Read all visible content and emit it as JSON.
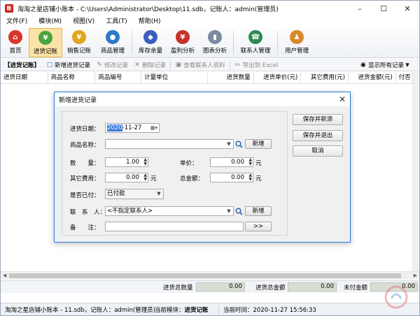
{
  "window": {
    "title": "淘淘之星店铺小账本 - C:\\Users\\Administrator\\Desktop\\11.sdb，记账人：admin(管理员)",
    "app_icon_text": "账"
  },
  "menu": [
    "文件(F)",
    "模块(M)",
    "视图(V)",
    "工具(T)",
    "帮助(H)"
  ],
  "toolbar": [
    {
      "label": "首页",
      "icon": "home-icon",
      "color": "#d9362a",
      "glyph": "⌂"
    },
    {
      "label": "进货记账",
      "icon": "purchase-icon",
      "color": "#4aa53c",
      "glyph": "¥",
      "active": true
    },
    {
      "label": "销售记账",
      "icon": "sales-icon",
      "color": "#e2a51b",
      "glyph": "¥"
    },
    {
      "label": "商品管理",
      "icon": "goods-icon",
      "color": "#2d78c8",
      "glyph": "●"
    },
    {
      "label": "库存余量",
      "icon": "stock-icon",
      "color": "#3b5fc0",
      "glyph": "◆"
    },
    {
      "label": "盈利分析",
      "icon": "profit-icon",
      "color": "#c8322a",
      "glyph": "¥"
    },
    {
      "label": "图表分析",
      "icon": "chart-icon",
      "color": "#7a8aa0",
      "glyph": "▮"
    },
    {
      "label": "联系人管理",
      "icon": "contacts-icon",
      "color": "#2f8a52",
      "glyph": "☎"
    },
    {
      "label": "用户管理",
      "icon": "users-icon",
      "color": "#d68a2a",
      "glyph": "♟"
    }
  ],
  "subbar": {
    "title": "【进货记账】",
    "new": "新增进货记录",
    "edit": "修改记录",
    "delete": "删除记录",
    "view_contact": "查看联系人资料",
    "export": "导出到 Excel",
    "show_all": "显示所有记录"
  },
  "columns": [
    "进货日期",
    "商品名称",
    "商品编号",
    "计量单位",
    "进货数量",
    "进货单价(元)",
    "其它费用(元)",
    "进货金额(元)",
    "付否"
  ],
  "totals": {
    "qty_label": "进货总数量",
    "qty_value": "0.00",
    "amount_label": "进货总金额",
    "amount_value": "0.00",
    "unpaid_label": "未付金额",
    "unpaid_value": "0.00"
  },
  "status": {
    "file": "淘淘之星店铺小账本 - 11.sdb，记账人：admin(管理员)",
    "module_label": "当前模块：",
    "module_value": "进货记账",
    "time_label": "当前时间：",
    "time_value": "2020-11-27 15:56:33"
  },
  "dialog": {
    "title": "新增进货记录",
    "date_label": "进货日期：",
    "date_year": "2020",
    "date_rest": "-11-27",
    "goods_label": "商品名称：",
    "goods_value": "",
    "add_goods": "新增",
    "qty_label": "数　　量：",
    "qty_value": "1.00",
    "price_label": "单价：",
    "price_value": "0.00",
    "price_unit": "元",
    "fee_label": "其它费用：",
    "fee_value": "0.00",
    "fee_unit": "元",
    "total_label": "总金额：",
    "total_value": "0.00",
    "total_unit": "元",
    "paid_label": "是否已付：",
    "paid_value": "已付款",
    "contact_label": "联　系　人：",
    "contact_value": "<不指定联系人>",
    "add_contact": "新增",
    "note_label": "备　　注：",
    "note_value": "",
    "note_btn": ">>",
    "save_add": "保存并新添",
    "save_exit": "保存并退出",
    "cancel": "取消"
  }
}
